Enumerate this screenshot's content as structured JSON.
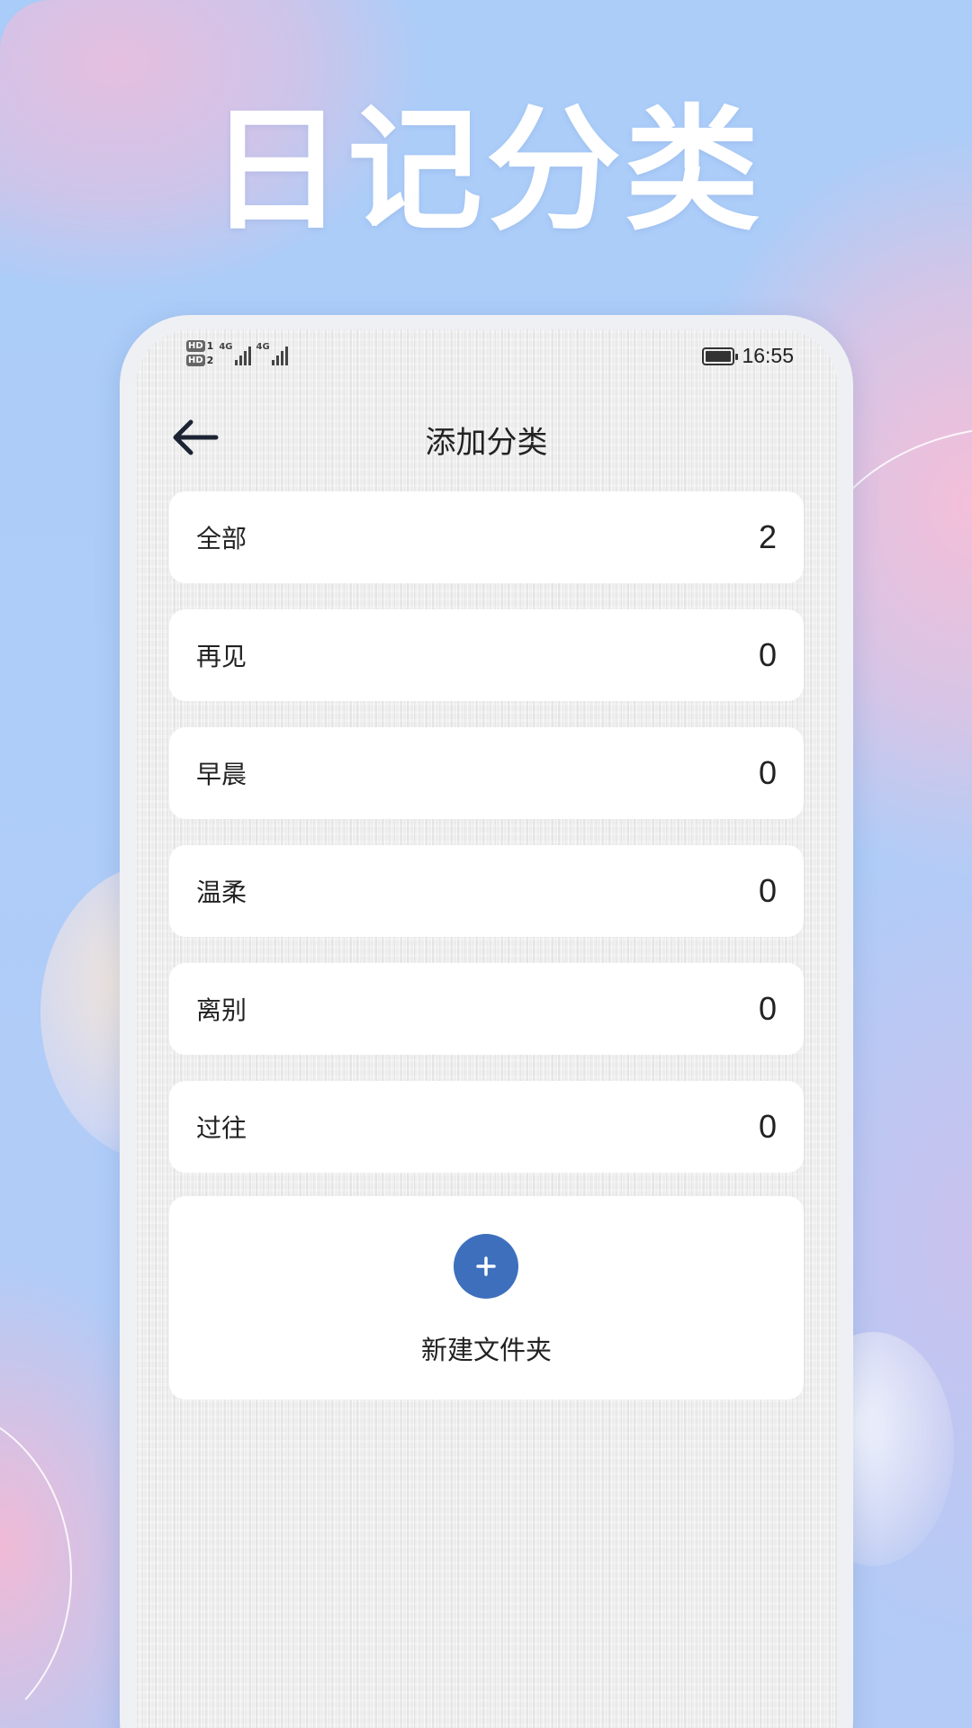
{
  "headline": "日记分类",
  "status_bar": {
    "sim1": "HD",
    "sim1_index": "1",
    "sim2": "HD",
    "sim2_index": "2",
    "network1": "4G",
    "network2": "4G",
    "time": "16:55"
  },
  "nav": {
    "title": "添加分类"
  },
  "categories": [
    {
      "name": "全部",
      "count": "2"
    },
    {
      "name": "再见",
      "count": "0"
    },
    {
      "name": "早晨",
      "count": "0"
    },
    {
      "name": "温柔",
      "count": "0"
    },
    {
      "name": "离别",
      "count": "0"
    },
    {
      "name": "过往",
      "count": "0"
    }
  ],
  "new_folder": {
    "label": "新建文件夹"
  },
  "colors": {
    "accent": "#3d6fbd",
    "background": "#a9ccf8",
    "card": "#ffffff"
  },
  "icons": {
    "back": "arrow-left-icon",
    "add": "plus-icon",
    "battery": "battery-icon",
    "signal": "signal-icon"
  }
}
